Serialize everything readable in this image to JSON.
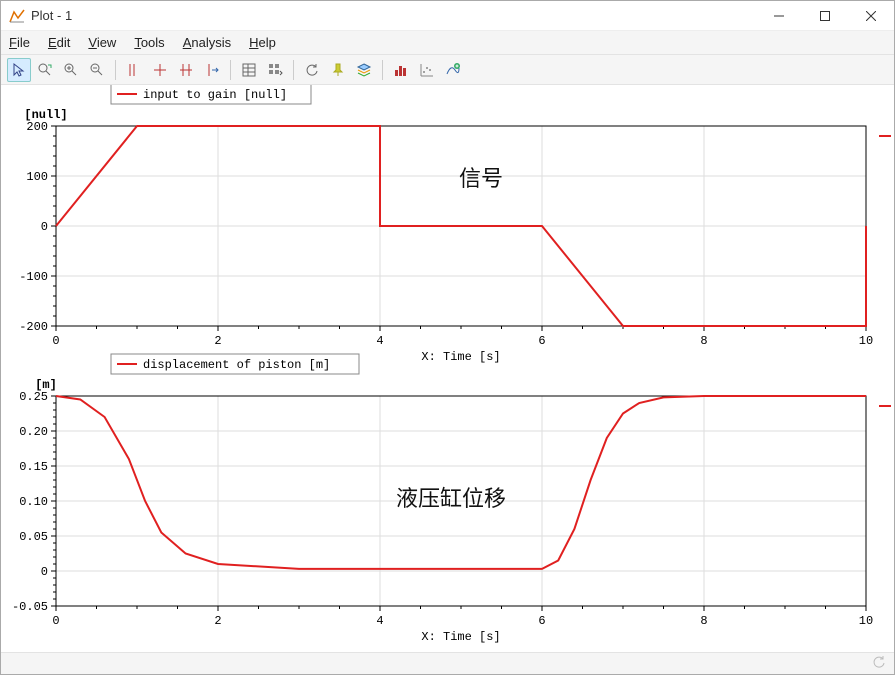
{
  "window": {
    "title": "Plot - 1"
  },
  "menu": {
    "file": "File",
    "edit": "Edit",
    "view": "View",
    "tools": "Tools",
    "analysis": "Analysis",
    "help": "Help"
  },
  "toolbar_icons": {
    "pointer": "pointer",
    "auto_zoom": "auto-zoom",
    "zoom_in": "zoom-in",
    "zoom_out": "zoom-out",
    "marker1": "marker-add",
    "marker2": "marker-single",
    "marker3": "marker-multi",
    "marker4": "marker-move",
    "table": "table-view",
    "grid": "grid-options",
    "refresh": "refresh",
    "pin": "pin",
    "layers": "layers",
    "hist": "histogram",
    "scatter": "scatter",
    "add_curve": "add-curve"
  },
  "chart_data": [
    {
      "type": "line",
      "legend": "input to gain [null]",
      "y_unit_label": "[null]",
      "xlabel": "X: Time [s]",
      "annotation": "信号",
      "xlim": [
        0,
        10
      ],
      "ylim": [
        -200,
        200
      ],
      "xticks": [
        0,
        2,
        4,
        6,
        8,
        10
      ],
      "yticks": [
        -200,
        -100,
        0,
        100,
        200
      ],
      "series": [
        {
          "name": "input to gain",
          "x": [
            0,
            1,
            4,
            4,
            6,
            7,
            10,
            10
          ],
          "y": [
            0,
            200,
            200,
            0,
            0,
            -200,
            -200,
            0
          ]
        }
      ]
    },
    {
      "type": "line",
      "legend": "displacement of piston [m]",
      "y_unit_label": "[m]",
      "xlabel": "X: Time [s]",
      "annotation": "液压缸位移",
      "xlim": [
        0,
        10
      ],
      "ylim": [
        -0.05,
        0.25
      ],
      "xticks": [
        0,
        2,
        4,
        6,
        8,
        10
      ],
      "yticks": [
        -0.05,
        0.0,
        0.05,
        0.1,
        0.15,
        0.2,
        0.25
      ],
      "series": [
        {
          "name": "displacement of piston",
          "x": [
            0,
            0.3,
            0.6,
            0.9,
            1.1,
            1.3,
            1.6,
            2.0,
            3.0,
            4.0,
            5.0,
            6.0,
            6.2,
            6.4,
            6.6,
            6.8,
            7.0,
            7.2,
            7.5,
            8.0,
            9.0,
            10.0
          ],
          "y": [
            0.25,
            0.245,
            0.22,
            0.16,
            0.1,
            0.055,
            0.025,
            0.01,
            0.003,
            0.003,
            0.003,
            0.003,
            0.015,
            0.06,
            0.13,
            0.19,
            0.225,
            0.24,
            0.248,
            0.25,
            0.25,
            0.25
          ]
        }
      ]
    }
  ]
}
